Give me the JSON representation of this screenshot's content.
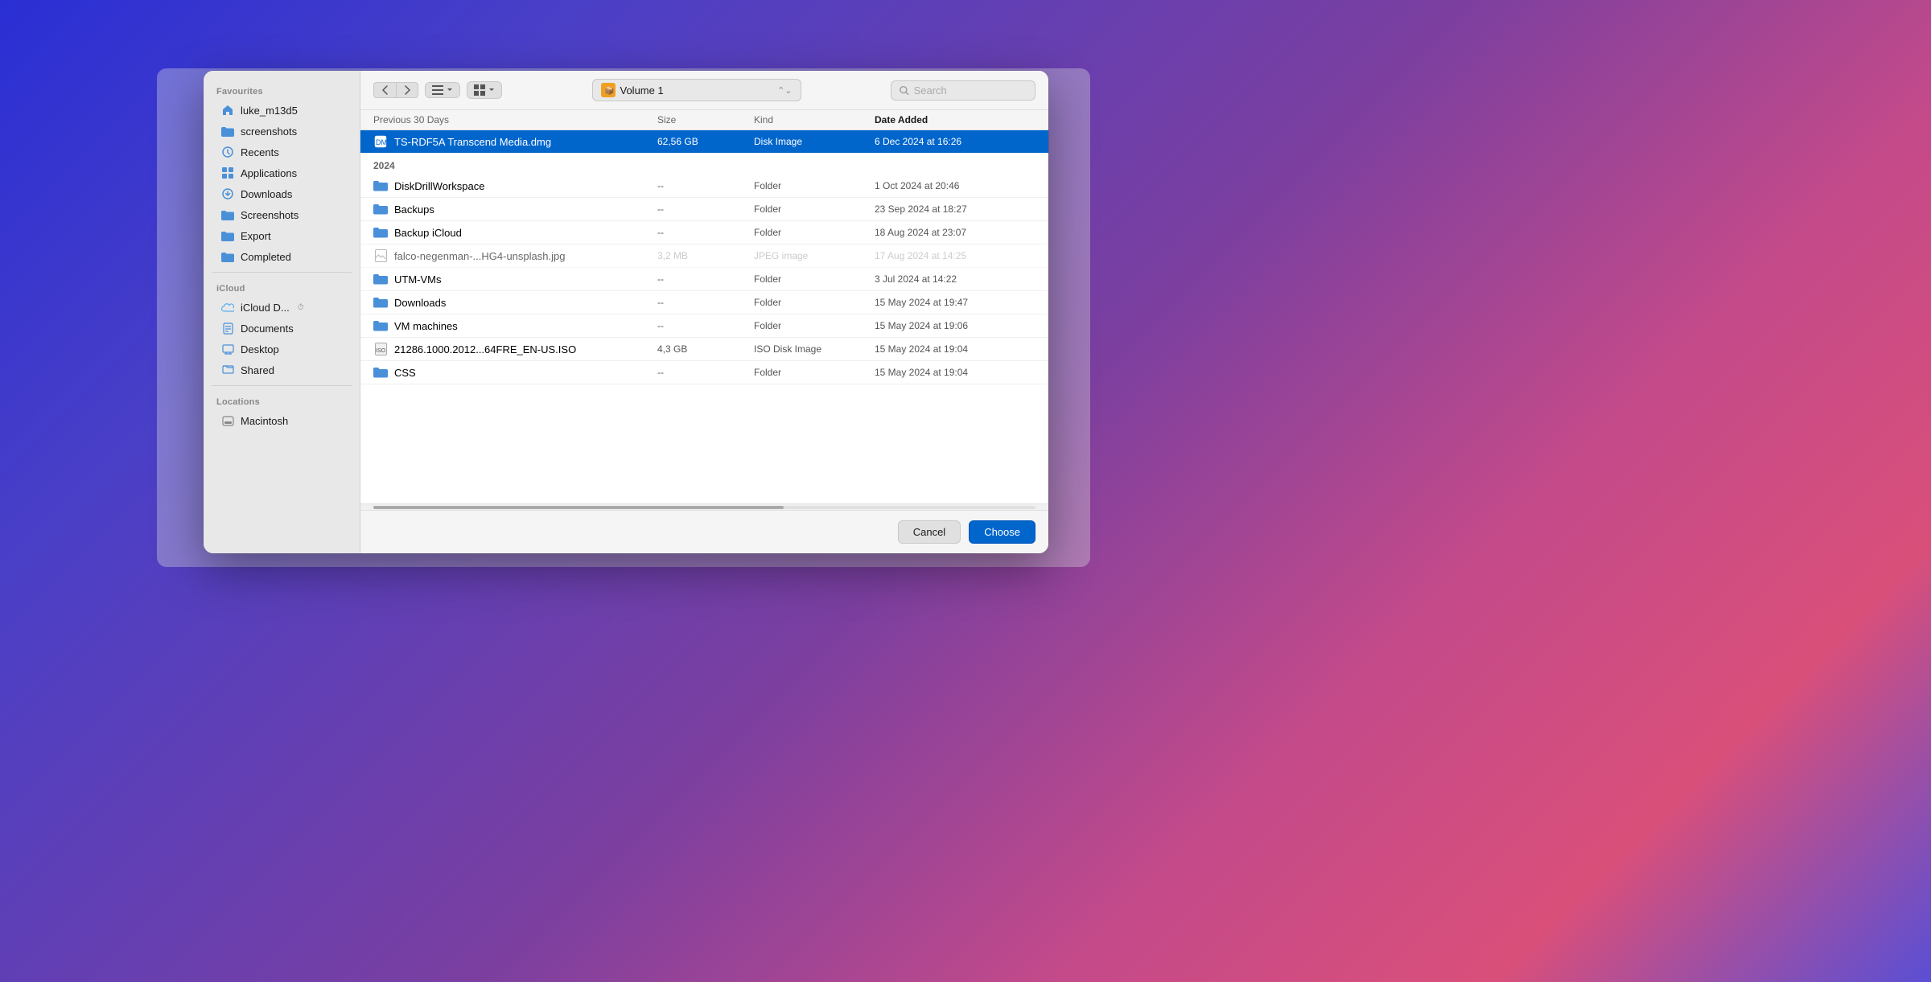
{
  "background": {
    "gradient": "purple-blue-pink"
  },
  "dialog": {
    "toolbar": {
      "back_label": "‹",
      "forward_label": "›",
      "list_view_label": "≡",
      "grid_view_label": "⊞",
      "location_name": "Volume 1",
      "location_icon": "🟧",
      "search_placeholder": "Search"
    },
    "file_list": {
      "columns": [
        "Previous 30 Days",
        "Size",
        "Kind",
        "Date Added"
      ],
      "selected_file": {
        "name": "TS-RDF5A Transcend Media.dmg",
        "size": "62,56 GB",
        "kind": "Disk Image",
        "date": "6 Dec 2024 at 16:26"
      },
      "section_2024": "2024",
      "files": [
        {
          "name": "DiskDrillWorkspace",
          "size": "--",
          "kind": "Folder",
          "date": "1 Oct 2024 at 20:46",
          "type": "folder"
        },
        {
          "name": "Backups",
          "size": "--",
          "kind": "Folder",
          "date": "23 Sep 2024 at 18:27",
          "type": "folder"
        },
        {
          "name": "Backup iCloud",
          "size": "--",
          "kind": "Folder",
          "date": "18 Aug 2024 at 23:07",
          "type": "folder"
        },
        {
          "name": "falco-negenman-...HG4-unsplash.jpg",
          "size": "3,2 MB",
          "kind": "JPEG image",
          "date": "17 Aug 2024 at 14:25",
          "type": "image"
        },
        {
          "name": "UTM-VMs",
          "size": "--",
          "kind": "Folder",
          "date": "3 Jul 2024 at 14:22",
          "type": "folder"
        },
        {
          "name": "Downloads",
          "size": "--",
          "kind": "Folder",
          "date": "15 May 2024 at 19:47",
          "type": "folder"
        },
        {
          "name": "VM machines",
          "size": "--",
          "kind": "Folder",
          "date": "15 May 2024 at 19:06",
          "type": "folder"
        },
        {
          "name": "21286.1000.2012...64FRE_EN-US.ISO",
          "size": "4,3 GB",
          "kind": "ISO Disk Image",
          "date": "15 May 2024 at 19:04",
          "type": "iso"
        },
        {
          "name": "CSS",
          "size": "--",
          "kind": "Folder",
          "date": "15 May 2024 at 19:04",
          "type": "folder"
        }
      ]
    },
    "footer": {
      "cancel_label": "Cancel",
      "choose_label": "Choose"
    }
  },
  "sidebar": {
    "favourites_label": "Favourites",
    "items_favourites": [
      {
        "id": "luke_m13d5",
        "label": "luke_m13d5",
        "icon": "home"
      },
      {
        "id": "screenshots",
        "label": "screenshots",
        "icon": "folder"
      },
      {
        "id": "recents",
        "label": "Recents",
        "icon": "clock"
      },
      {
        "id": "applications",
        "label": "Applications",
        "icon": "applications"
      },
      {
        "id": "downloads",
        "label": "Downloads",
        "icon": "downloads"
      },
      {
        "id": "screenshots2",
        "label": "Screenshots",
        "icon": "folder"
      },
      {
        "id": "export",
        "label": "Export",
        "icon": "folder"
      },
      {
        "id": "completed",
        "label": "Completed",
        "icon": "folder"
      }
    ],
    "icloud_label": "iCloud",
    "items_icloud": [
      {
        "id": "icloud_drive",
        "label": "iCloud D...",
        "icon": "icloud",
        "badge": "⏱"
      },
      {
        "id": "documents",
        "label": "Documents",
        "icon": "doc"
      },
      {
        "id": "desktop",
        "label": "Desktop",
        "icon": "desktop"
      },
      {
        "id": "shared",
        "label": "Shared",
        "icon": "shared"
      }
    ],
    "locations_label": "Locations",
    "items_locations": [
      {
        "id": "macintosh",
        "label": "Macintosh",
        "icon": "disk"
      }
    ]
  }
}
